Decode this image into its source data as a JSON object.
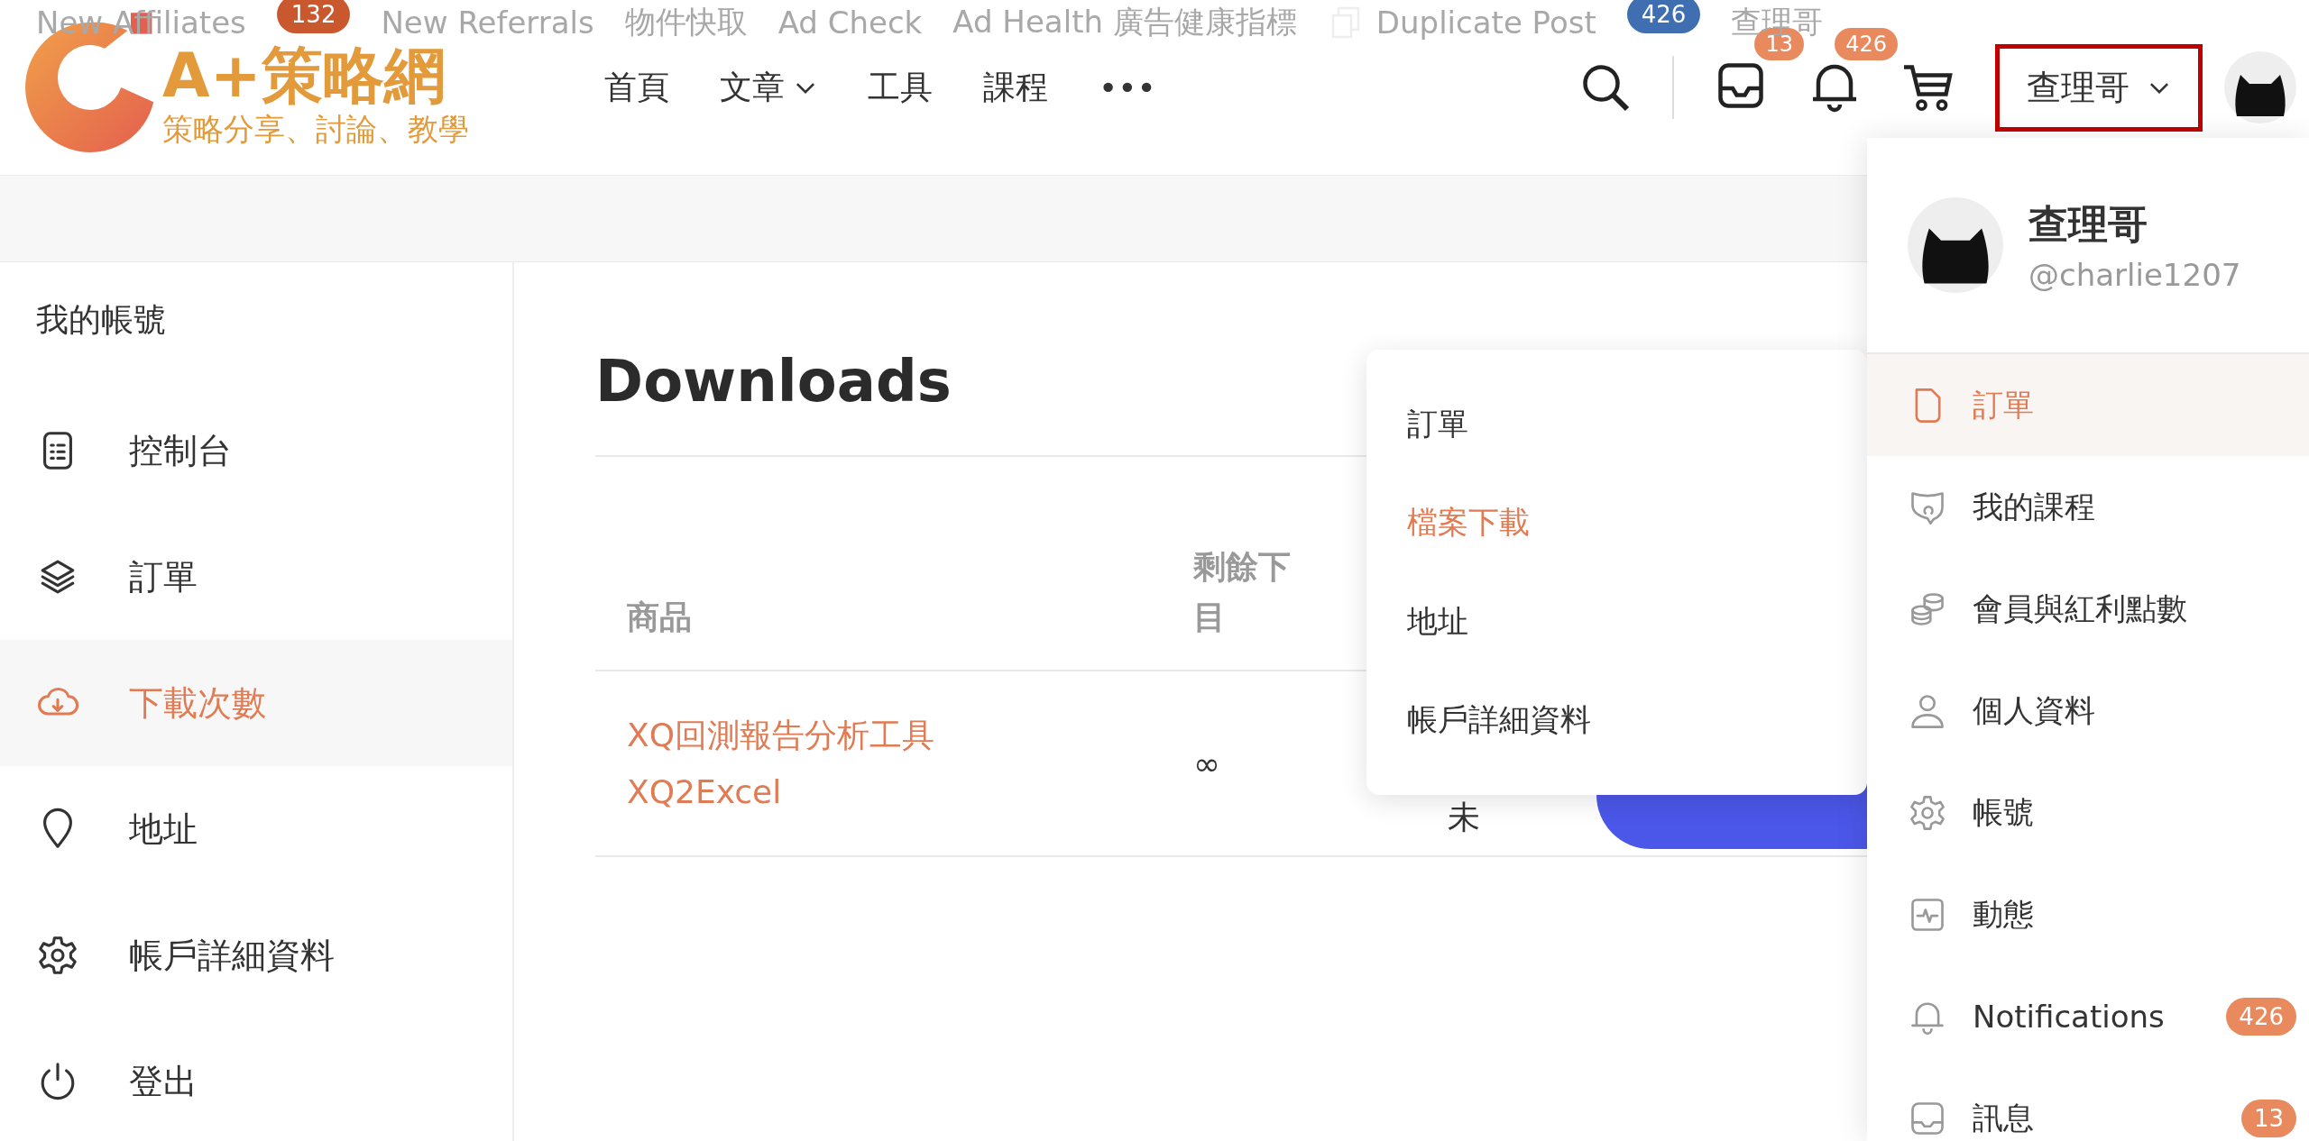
{
  "admin_bar": {
    "items": [
      {
        "kind": "text",
        "label": "New Affiliates"
      },
      {
        "kind": "badge",
        "label": "132",
        "color": "#c9582f"
      },
      {
        "kind": "text",
        "label": "New Referrals"
      },
      {
        "kind": "text",
        "label": "物件快取"
      },
      {
        "kind": "text",
        "label": "Ad Check"
      },
      {
        "kind": "text",
        "label": "Ad Health 廣告健康指標"
      },
      {
        "kind": "copy",
        "label": "Duplicate Post"
      },
      {
        "kind": "badge",
        "label": "426",
        "color": "#3f6fb0"
      },
      {
        "kind": "text",
        "label": "查理哥"
      }
    ]
  },
  "header": {
    "logo": {
      "title": "A+策略網",
      "tagline": "策略分享、討論、教學"
    },
    "nav": [
      {
        "label": "首頁",
        "has_dropdown": false
      },
      {
        "label": "文章",
        "has_dropdown": true
      },
      {
        "label": "工具",
        "has_dropdown": false
      },
      {
        "label": "課程",
        "has_dropdown": false
      },
      {
        "label": "•••",
        "has_dropdown": false
      }
    ],
    "inbox_badge": "13",
    "notifications_badge": "426",
    "user": {
      "name": "查理哥",
      "highlighted": true
    }
  },
  "sidebar": {
    "title": "我的帳號",
    "items": [
      {
        "label": "控制台",
        "selected": false
      },
      {
        "label": "訂單",
        "selected": false
      },
      {
        "label": "下載次數",
        "selected": true
      },
      {
        "label": "地址",
        "selected": false
      },
      {
        "label": "帳戶詳細資料",
        "selected": false
      },
      {
        "label": "登出",
        "selected": false
      }
    ]
  },
  "main": {
    "title": "Downloads",
    "table": {
      "columns": [
        {
          "lines": [
            "商品"
          ]
        },
        {
          "lines": [
            "剩餘下",
            "目"
          ]
        }
      ],
      "rows": [
        {
          "product": "XQ回測報告分析工具 XQ2Excel",
          "remaining": "∞",
          "column_3": "未"
        }
      ]
    }
  },
  "submenu": {
    "items": [
      {
        "label": "訂單",
        "selected": false
      },
      {
        "label": "檔案下載",
        "selected": true
      },
      {
        "label": "地址",
        "selected": false
      },
      {
        "label": "帳戶詳細資料",
        "selected": false
      }
    ]
  },
  "user_panel": {
    "name": "查理哥",
    "handle": "@charlie1207",
    "items": [
      {
        "label": "訂單",
        "selected": true
      },
      {
        "label": "我的課程",
        "selected": false
      },
      {
        "label": "會員與紅利點數",
        "selected": false
      },
      {
        "label": "個人資料",
        "selected": false
      },
      {
        "label": "帳號",
        "selected": false
      },
      {
        "label": "動態",
        "selected": false
      },
      {
        "label": "Notifications",
        "selected": false,
        "badge": "426"
      },
      {
        "label": "訊息",
        "selected": false,
        "badge": "13"
      }
    ]
  }
}
